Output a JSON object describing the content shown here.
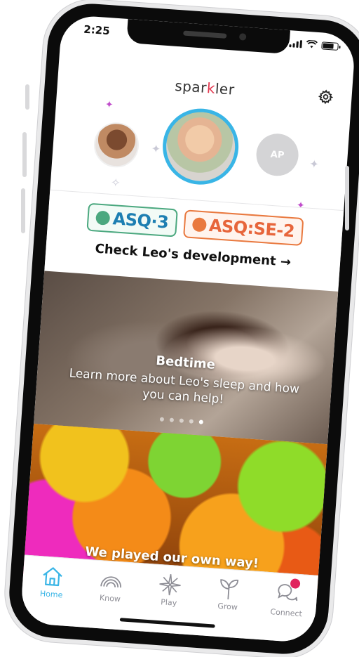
{
  "status_bar": {
    "time": "2:25"
  },
  "header": {
    "logo": {
      "pre": "spar",
      "accent": "k",
      "post": "ler"
    }
  },
  "profiles": {
    "initials": "AP"
  },
  "asq": {
    "logo_asq3": "ASQ·3",
    "logo_asqse2": "ASQ:SE-2",
    "check_link": "Check Leo's development →"
  },
  "cards": {
    "bedtime": {
      "title": "Bedtime",
      "subtitle": "Learn more about Leo's sleep and how you can help!",
      "page_count": 5,
      "active_page": 5
    },
    "play": {
      "title": "We played our own way!"
    }
  },
  "tabs": [
    {
      "label": "Home",
      "icon": "home-icon",
      "active": true
    },
    {
      "label": "Know",
      "icon": "rainbow-icon",
      "active": false
    },
    {
      "label": "Play",
      "icon": "sparkle-icon",
      "active": false
    },
    {
      "label": "Grow",
      "icon": "sprout-icon",
      "active": false
    },
    {
      "label": "Connect",
      "icon": "chat-bubbles-icon",
      "active": false,
      "notification": true
    }
  ],
  "colors": {
    "accent": "#39b5e6",
    "notification": "#e0245e",
    "asq3": "#4ba87f",
    "asqse2": "#e9793f"
  }
}
